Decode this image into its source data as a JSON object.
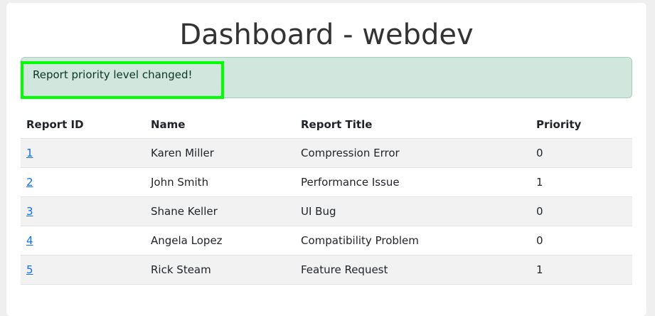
{
  "title": "Dashboard - webdev",
  "alert": "Report priority level changed!",
  "columns": [
    "Report ID",
    "Name",
    "Report Title",
    "Priority"
  ],
  "rows": [
    {
      "id": "1",
      "name": "Karen Miller",
      "title": "Compression Error",
      "priority": "0"
    },
    {
      "id": "2",
      "name": "John Smith",
      "title": "Performance Issue",
      "priority": "1"
    },
    {
      "id": "3",
      "name": "Shane Keller",
      "title": "UI Bug",
      "priority": "0"
    },
    {
      "id": "4",
      "name": "Angela Lopez",
      "title": "Compatibility Problem",
      "priority": "0"
    },
    {
      "id": "5",
      "name": "Rick Steam",
      "title": "Feature Request",
      "priority": "1"
    }
  ]
}
